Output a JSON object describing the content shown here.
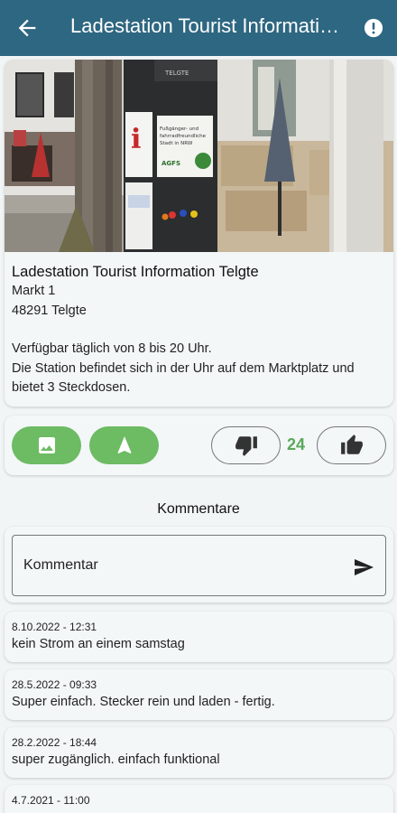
{
  "header": {
    "title": "Ladestation Tourist Information Telgte"
  },
  "station": {
    "name": "Ladestation Tourist Information Telgte",
    "street": "Markt 1",
    "city": "48291 Telgte",
    "availability": "Verfügbar täglich von 8 bis 20 Uhr.",
    "description_1": "Die Station befindet sich in der Uhr auf dem Marktplatz und",
    "description_2": "bietet 3 Steckdosen."
  },
  "photo": {
    "sign_text": "Fußgänger- und fahrradfreundliche Stadt in NRW",
    "sign_badge": "AGFS",
    "top_text": "TELGTE"
  },
  "actions": {
    "vote_count": "24"
  },
  "comments_section": {
    "title": "Kommentare",
    "input_placeholder": "Kommentar"
  },
  "comments": [
    {
      "date": "8.10.2022 - 12:31",
      "text": "kein Strom an einem samstag"
    },
    {
      "date": "28.5.2022 - 09:33",
      "text": "Super einfach. Stecker rein und laden - fertig."
    },
    {
      "date": "28.2.2022 - 18:44",
      "text": "super zugänglich. einfach funktional"
    },
    {
      "date": "4.7.2021 - 11:00",
      "text": ""
    }
  ],
  "colors": {
    "appbar": "#2e6781",
    "accent_green": "#6dbb63",
    "count_green": "#5aa85a",
    "background": "#f2f5f6"
  }
}
